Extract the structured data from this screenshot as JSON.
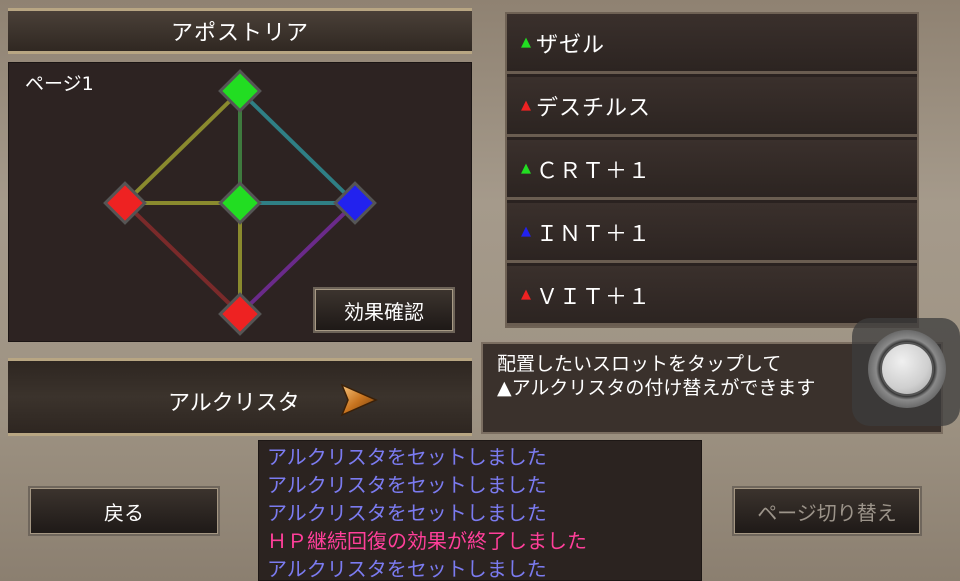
{
  "header": {
    "title": "アポストリア"
  },
  "board": {
    "page_label": "ページ1",
    "effect_button_label": "効果確認",
    "nodes": [
      {
        "name": "top",
        "color": "#22dd22"
      },
      {
        "name": "left",
        "color": "#ee2222"
      },
      {
        "name": "center",
        "color": "#22dd22"
      },
      {
        "name": "right",
        "color": "#2222ee"
      },
      {
        "name": "bottom",
        "color": "#ee2222"
      }
    ]
  },
  "crysta": {
    "label": "アルクリスタ",
    "arrow_icon": "play-arrow-icon"
  },
  "slots": [
    {
      "marker": "▲",
      "marker_color": "#22dd22",
      "text": "ザゼル"
    },
    {
      "marker": "▲",
      "marker_color": "#ee2222",
      "text": "デスチルス"
    },
    {
      "marker": "▲",
      "marker_color": "#22dd22",
      "text": "ＣＲＴ＋１"
    },
    {
      "marker": "▲",
      "marker_color": "#2222ee",
      "text": "ＩＮＴ＋１"
    },
    {
      "marker": "▲",
      "marker_color": "#ee2222",
      "text": "ＶＩＴ＋１"
    }
  ],
  "message": {
    "line1": "配置したいスロットをタップして",
    "line2": "▲アルクリスタの付け替えができます"
  },
  "log": [
    {
      "text": "アルクリスタをセットしました",
      "color": "#7b7bf0"
    },
    {
      "text": "アルクリスタをセットしました",
      "color": "#7b7bf0"
    },
    {
      "text": "アルクリスタをセットしました",
      "color": "#7b7bf0"
    },
    {
      "text": "ＨＰ継続回復の効果が終了しました",
      "color": "#ff3f9a"
    },
    {
      "text": "アルクリスタをセットしました",
      "color": "#7b7bf0"
    }
  ],
  "buttons": {
    "back_label": "戻る",
    "page_switch_label": "ページ切り替え"
  }
}
